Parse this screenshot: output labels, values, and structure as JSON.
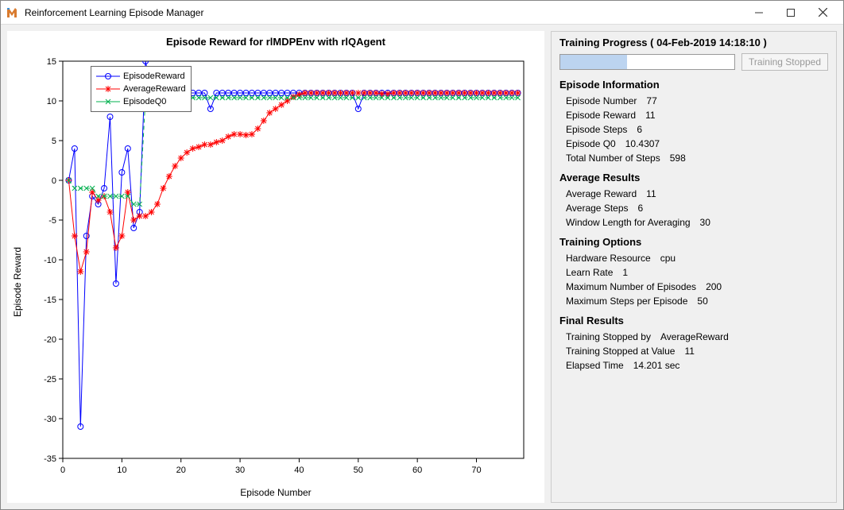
{
  "window": {
    "title": "Reinforcement Learning Episode Manager"
  },
  "chart": {
    "title": "Episode Reward for rlMDPEnv with rlQAgent",
    "xlabel": "Episode Number",
    "ylabel": "Episode Reward",
    "legend": {
      "items": [
        "EpisodeReward",
        "AverageReward",
        "EpisodeQ0"
      ]
    }
  },
  "side": {
    "header": "Training Progress ( 04-Feb-2019 14:18:10 )",
    "progress_fraction": 0.385,
    "stop_button": "Training Stopped",
    "sections": {
      "episode_info": {
        "title": "Episode Information",
        "rows": [
          {
            "label": "Episode Number",
            "value": "77"
          },
          {
            "label": "Episode Reward",
            "value": "11"
          },
          {
            "label": "Episode Steps",
            "value": "6"
          },
          {
            "label": "Episode Q0",
            "value": "10.4307"
          },
          {
            "label": "Total Number of Steps",
            "value": "598"
          }
        ]
      },
      "average_results": {
        "title": "Average Results",
        "rows": [
          {
            "label": "Average Reward",
            "value": "11"
          },
          {
            "label": "Average Steps",
            "value": "6"
          },
          {
            "label": "Window Length for Averaging",
            "value": "30"
          }
        ]
      },
      "training_options": {
        "title": "Training Options",
        "rows": [
          {
            "label": "Hardware Resource",
            "value": "cpu"
          },
          {
            "label": "Learn Rate",
            "value": "1"
          },
          {
            "label": "Maximum Number of Episodes",
            "value": "200"
          },
          {
            "label": "Maximum Steps per Episode",
            "value": "50"
          }
        ]
      },
      "final_results": {
        "title": "Final Results",
        "rows": [
          {
            "label": "Training Stopped by",
            "value": "AverageReward"
          },
          {
            "label": "Training Stopped at Value",
            "value": "11"
          },
          {
            "label": "Elapsed Time",
            "value": "14.201 sec"
          }
        ]
      }
    }
  },
  "chart_data": {
    "type": "line",
    "xlabel": "Episode Number",
    "ylabel": "Episode Reward",
    "xlim": [
      0,
      78
    ],
    "ylim": [
      -35,
      15
    ],
    "xticks": [
      0,
      10,
      20,
      30,
      40,
      50,
      60,
      70
    ],
    "yticks": [
      -35,
      -30,
      -25,
      -20,
      -15,
      -10,
      -5,
      0,
      5,
      10,
      15
    ],
    "series": [
      {
        "name": "EpisodeReward",
        "color": "#0000ff",
        "marker": "circle",
        "y": [
          0,
          4,
          -31,
          -7,
          -2,
          -3,
          -1,
          8,
          -13,
          1,
          4,
          -6,
          -4,
          15,
          11,
          11,
          11,
          11,
          11,
          11,
          11,
          11,
          11,
          11,
          9,
          11,
          11,
          11,
          11,
          11,
          11,
          11,
          11,
          11,
          11,
          11,
          11,
          11,
          11,
          11,
          11,
          11,
          11,
          11,
          11,
          11,
          11,
          11,
          11,
          9,
          11,
          11,
          11,
          11,
          11,
          11,
          11,
          11,
          11,
          11,
          11,
          11,
          11,
          11,
          11,
          11,
          11,
          11,
          11,
          11,
          11,
          11,
          11,
          11,
          11,
          11,
          11
        ]
      },
      {
        "name": "AverageReward",
        "color": "#ff0000",
        "marker": "star",
        "y": [
          0,
          -7,
          -11.5,
          -9,
          -1.5,
          -2.5,
          -2,
          -4,
          -8.5,
          -7,
          -1.5,
          -5,
          -4.5,
          -4.5,
          -4,
          -3,
          -1,
          0.5,
          1.8,
          2.8,
          3.5,
          4,
          4.2,
          4.5,
          4.5,
          4.8,
          5,
          5.5,
          5.8,
          5.8,
          5.7,
          5.8,
          6.5,
          7.5,
          8.5,
          9,
          9.5,
          10,
          10.5,
          10.8,
          11,
          11,
          11,
          11,
          11,
          11,
          11,
          11,
          11,
          11,
          11,
          11,
          11,
          10.9,
          10.9,
          11,
          11,
          11,
          11,
          11,
          11,
          11,
          11,
          11,
          11,
          11,
          11,
          11,
          11,
          11,
          11,
          11,
          11,
          11,
          11,
          11,
          11
        ]
      },
      {
        "name": "EpisodeQ0",
        "color": "#00b04f",
        "marker": "x",
        "y": [
          0,
          -1,
          -1,
          -1,
          -1,
          -2,
          -2,
          -2,
          -2,
          -2,
          -2,
          -3,
          -3,
          10.4,
          10.4,
          10.4,
          10.4,
          10.4,
          10.4,
          10.4,
          10.4,
          10.4,
          10.4,
          10.4,
          10.4,
          10.4,
          10.4,
          10.4,
          10.4,
          10.4,
          10.4,
          10.4,
          10.4,
          10.4,
          10.4,
          10.4,
          10.4,
          10.4,
          10.4,
          10.4,
          10.4,
          10.4,
          10.4,
          10.4,
          10.4,
          10.4,
          10.4,
          10.4,
          10.4,
          10.4,
          10.4,
          10.4,
          10.4,
          10.4,
          10.4,
          10.4,
          10.4,
          10.4,
          10.4,
          10.4,
          10.4,
          10.4,
          10.4,
          10.4,
          10.4,
          10.4,
          10.4,
          10.4,
          10.4,
          10.4,
          10.4,
          10.4,
          10.4,
          10.4,
          10.4,
          10.4,
          10.4
        ]
      }
    ]
  }
}
